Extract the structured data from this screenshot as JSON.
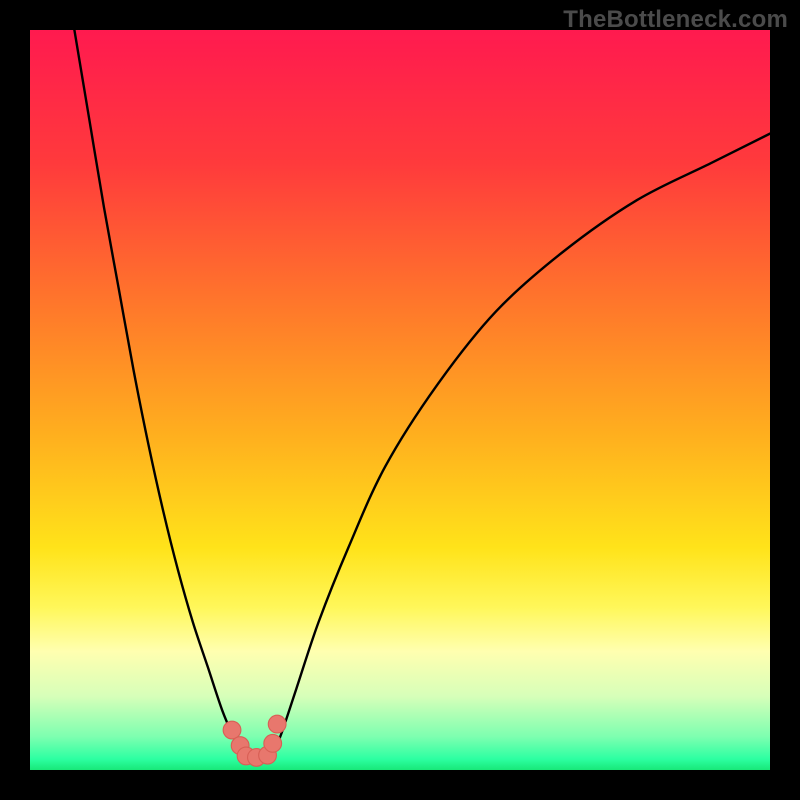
{
  "watermark": "TheBottleneck.com",
  "colors": {
    "black": "#000000",
    "curve": "#000000",
    "marker_fill": "#e8776d",
    "marker_stroke": "#d85f55",
    "gradient_stops": [
      {
        "offset": 0.0,
        "color": "#ff1a4f"
      },
      {
        "offset": 0.18,
        "color": "#ff3a3c"
      },
      {
        "offset": 0.38,
        "color": "#ff7a2a"
      },
      {
        "offset": 0.55,
        "color": "#ffb01e"
      },
      {
        "offset": 0.7,
        "color": "#ffe31a"
      },
      {
        "offset": 0.78,
        "color": "#fff75a"
      },
      {
        "offset": 0.84,
        "color": "#ffffb0"
      },
      {
        "offset": 0.9,
        "color": "#d7ffb9"
      },
      {
        "offset": 0.955,
        "color": "#7dffb0"
      },
      {
        "offset": 0.985,
        "color": "#2dffa2"
      },
      {
        "offset": 1.0,
        "color": "#18e878"
      }
    ]
  },
  "chart_data": {
    "type": "line",
    "title": "",
    "xlabel": "",
    "ylabel": "",
    "xlim": [
      0,
      100
    ],
    "ylim": [
      0,
      100
    ],
    "grid": false,
    "legend": false,
    "series": [
      {
        "name": "left-branch",
        "x": [
          6,
          8,
          10,
          12,
          14,
          16,
          18,
          20,
          22,
          24,
          26,
          27.5,
          28.5
        ],
        "y": [
          100,
          88,
          76,
          65,
          54,
          44,
          35,
          27,
          20,
          14,
          8,
          4.5,
          2.5
        ]
      },
      {
        "name": "right-branch",
        "x": [
          33,
          34,
          36,
          39,
          43,
          48,
          55,
          63,
          72,
          82,
          92,
          100
        ],
        "y": [
          2.5,
          5,
          11,
          20,
          30,
          41,
          52,
          62,
          70,
          77,
          82,
          86
        ]
      },
      {
        "name": "valley-floor",
        "x": [
          28.5,
          29.5,
          31,
          32,
          33
        ],
        "y": [
          2.5,
          1.8,
          1.6,
          1.8,
          2.5
        ]
      }
    ],
    "markers": {
      "name": "valley-markers",
      "x": [
        27.3,
        28.4,
        29.2,
        30.6,
        32.1,
        32.8,
        33.4
      ],
      "y": [
        5.4,
        3.3,
        1.9,
        1.7,
        2.0,
        3.6,
        6.2
      ],
      "r": 1.2
    }
  }
}
